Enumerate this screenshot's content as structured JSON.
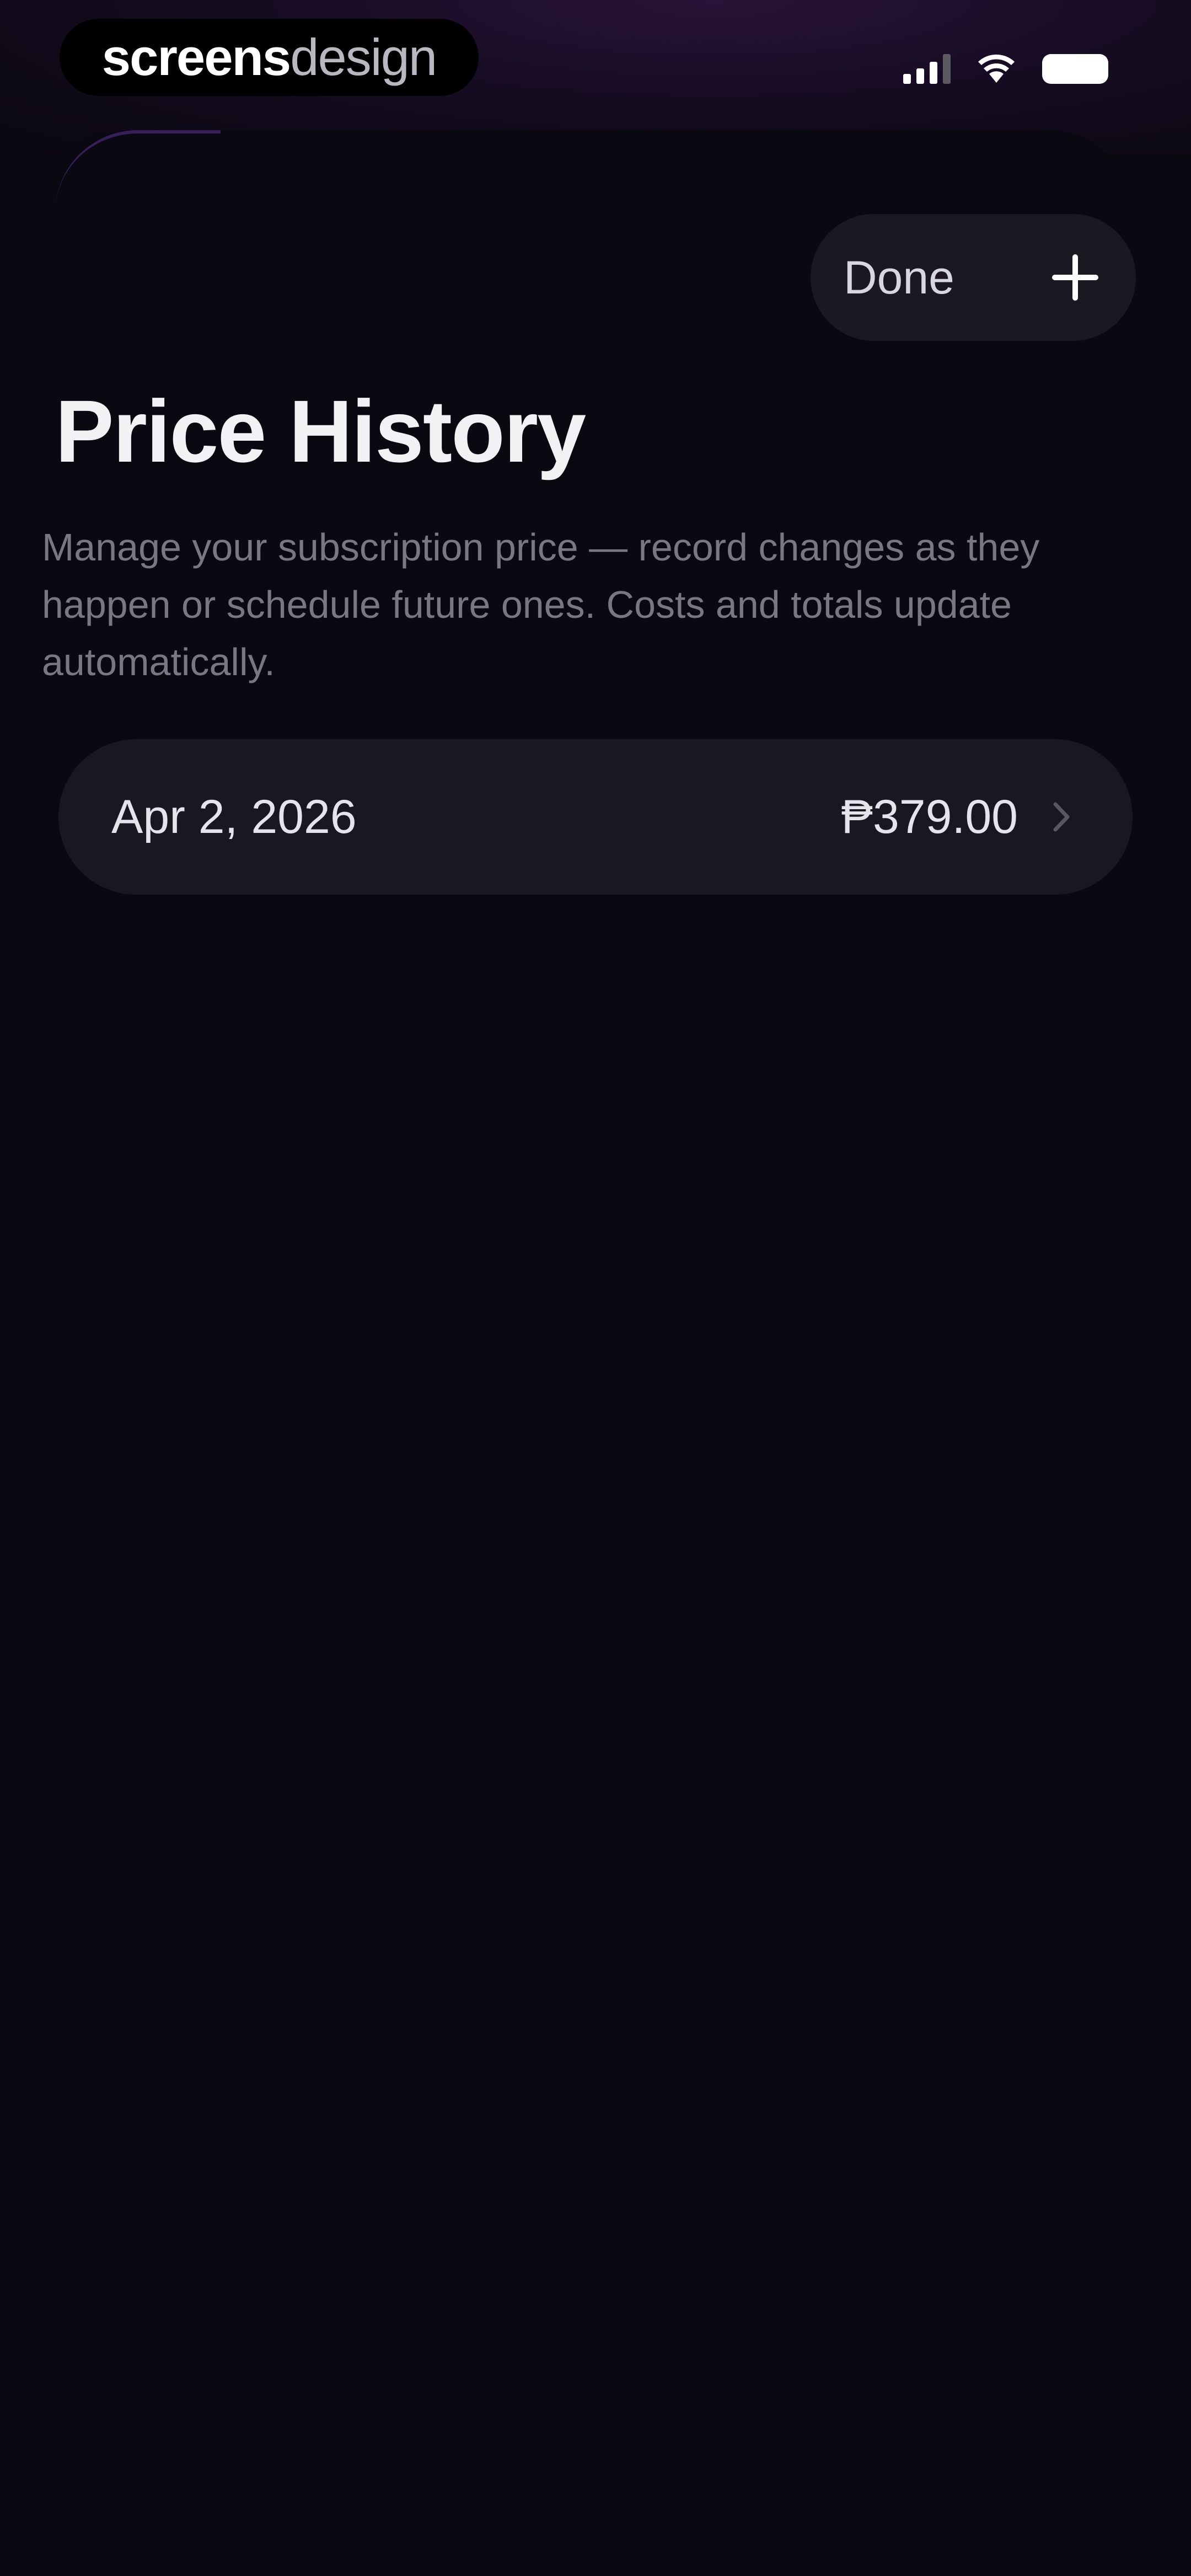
{
  "status_bar": {
    "brand_bold": "screens",
    "brand_light": "design"
  },
  "toolbar": {
    "done_label": "Done",
    "add_icon": "plus-icon"
  },
  "page": {
    "title": "Price History",
    "description": "Manage your subscription price — record changes as they happen or schedule future ones. Costs and totals update automatically."
  },
  "price_history": [
    {
      "date": "Apr 2, 2026",
      "amount": "₱379.00"
    }
  ],
  "colors": {
    "background": "#0a0810",
    "card": "#1a1720",
    "accent_glow": "#2a1238"
  }
}
